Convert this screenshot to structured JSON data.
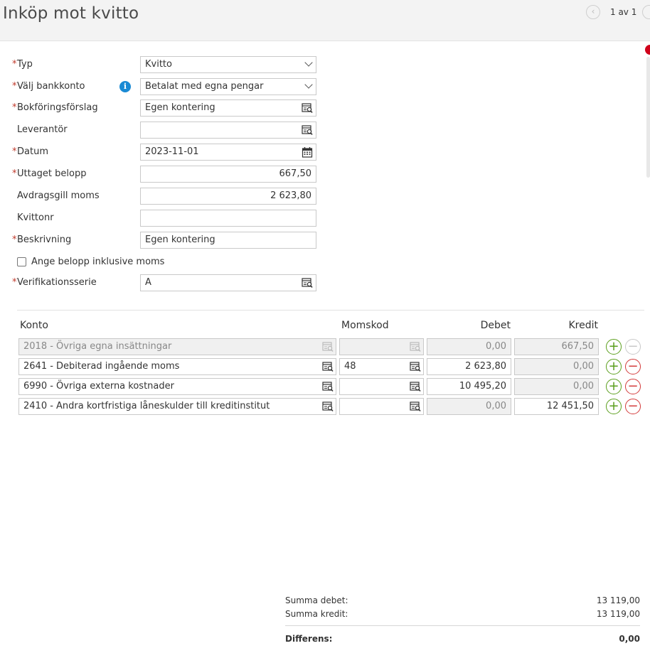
{
  "header": {
    "title": "Inköp mot kvitto",
    "pager": "1 av 1"
  },
  "form": {
    "typ": {
      "label": "Typ",
      "value": "Kvitto"
    },
    "bankkonto": {
      "label": "Välj bankkonto",
      "value": "Betalat med egna pengar"
    },
    "bokforingsforslag": {
      "label": "Bokföringsförslag",
      "value": "Egen kontering"
    },
    "leverantor": {
      "label": "Leverantör",
      "value": ""
    },
    "datum": {
      "label": "Datum",
      "value": "2023-11-01"
    },
    "uttaget_belopp": {
      "label": "Uttaget belopp",
      "value": "667,50"
    },
    "avdragsgill_moms": {
      "label": "Avdragsgill moms",
      "value": "2 623,80"
    },
    "kvittonr": {
      "label": "Kvittonr",
      "value": ""
    },
    "beskrivning": {
      "label": "Beskrivning",
      "value": "Egen kontering"
    },
    "inkl_moms": {
      "label": "Ange belopp inklusive moms",
      "checked": false
    },
    "verifikationsserie": {
      "label": "Verifikationsserie",
      "value": "A"
    }
  },
  "table": {
    "headers": {
      "konto": "Konto",
      "momskod": "Momskod",
      "debet": "Debet",
      "kredit": "Kredit"
    },
    "rows": [
      {
        "konto": "2018 - Övriga egna insättningar",
        "momskod": "",
        "debet": "0,00",
        "kredit": "667,50"
      },
      {
        "konto": "2641 - Debiterad ingående moms",
        "momskod": "48",
        "debet": "2 623,80",
        "kredit": "0,00"
      },
      {
        "konto": "6990 - Övriga externa kostnader",
        "momskod": "",
        "debet": "10 495,20",
        "kredit": "0,00"
      },
      {
        "konto": "2410 - Andra kortfristiga låneskulder till kreditinstitut",
        "momskod": "",
        "debet": "0,00",
        "kredit": "12 451,50"
      }
    ]
  },
  "summary": {
    "debet_label": "Summa debet:",
    "debet_value": "13 119,00",
    "kredit_label": "Summa kredit:",
    "kredit_value": "13 119,00",
    "diff_label": "Differens:",
    "diff_value": "0,00"
  },
  "colors": {
    "required": "#c0392b",
    "info": "#1a8ad4",
    "add": "#5a9e1c",
    "remove": "#d33a3a"
  },
  "icons": {
    "lookup": "lookup-icon",
    "calendar": "calendar-icon",
    "info": "info-icon",
    "chevron": "chevron-down-icon"
  }
}
